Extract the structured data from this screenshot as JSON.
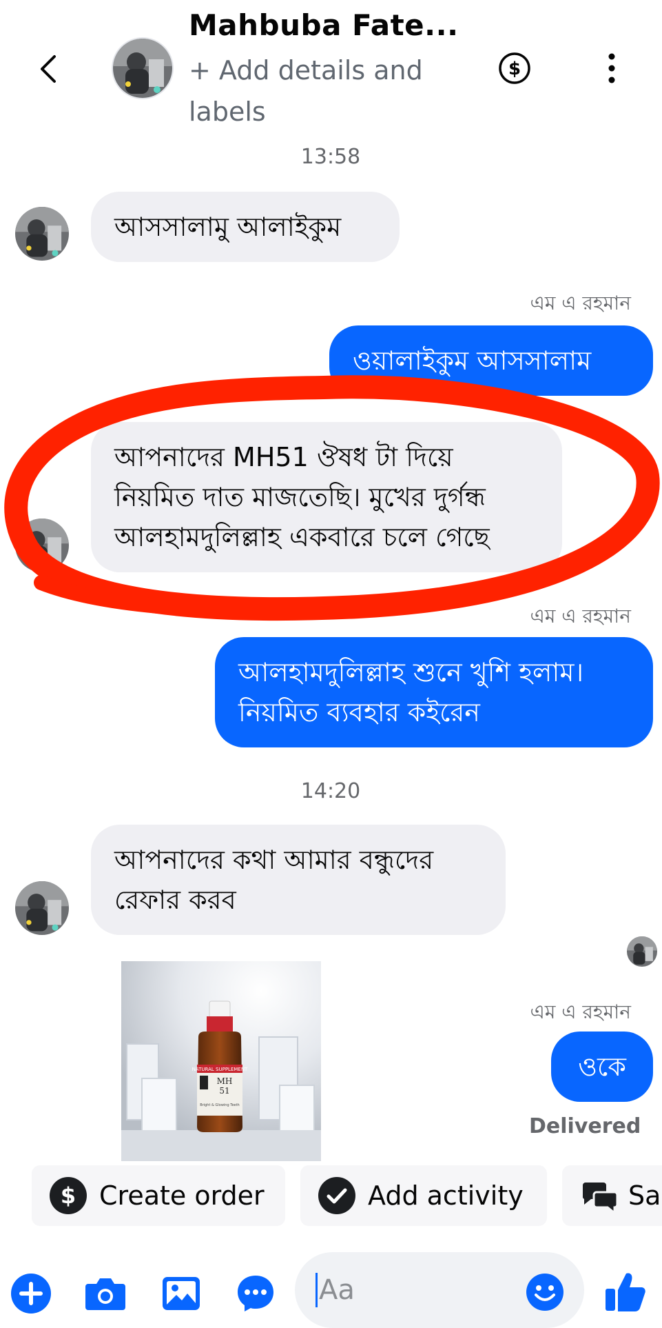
{
  "header": {
    "title": "Mahbuba Fate...",
    "subtitle": "+ Add details and labels"
  },
  "messages": {
    "time1": "13:58",
    "m1": "আসসালামু আলাইকুম",
    "sender1": "এম এ রহমান",
    "m2": "ওয়ালাইকুম আসসালাম",
    "m3": "আপনাদের MH51 ঔষধ টা দিয়ে নিয়মিত দাত মাজতেছি। মুখের দুর্গন্ধ আলহামদুলিল্লাহ একবারে চলে গেছে",
    "sender2": "এম এ রহমান",
    "m4": "আলহামদুলিল্লাহ শুনে খুশি হলাম। নিয়মিত ব্যবহার কইরেন",
    "time2": "14:20",
    "m5": "আপনাদের কথা আমার বন্ধুদের রেফার করব",
    "sender3": "এম এ রহমান",
    "m6": "ওকে",
    "status": "Delivered"
  },
  "product_image": {
    "banner": "NATURAL SUPPLEMENT",
    "label_line1": "MH",
    "label_line2": "51",
    "label_caption": "Bright & Glowing Teeth"
  },
  "quick_actions": {
    "create_order": "Create order",
    "add_activity": "Add activity",
    "third": "Sa"
  },
  "composer": {
    "placeholder": "Aa"
  },
  "icons": {
    "accent": "#0866ff",
    "annotation": "#ff2200"
  }
}
